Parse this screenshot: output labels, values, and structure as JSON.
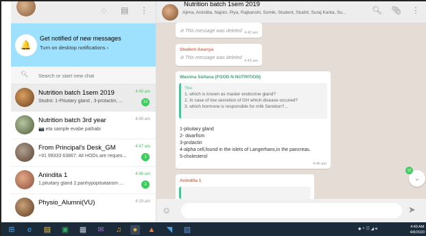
{
  "sidebar": {
    "notify_title": "Get notified of new messages",
    "notify_sub": "Turn on desktop notifications ›",
    "search_placeholder": "Search or start new chat",
    "chats": [
      {
        "name": "Nutrition batch 1sem 2019",
        "snippet": "Studnt: 1-Pituitary gland , 3-prolactin, ...",
        "time": "4:49 am",
        "badge": "12"
      },
      {
        "name": "Nutrition batch 3rd year",
        "snippet": "📷 eta sample evabe pathabi",
        "time": "4:49 am",
        "badge": ""
      },
      {
        "name": "From Principal's Desk_GM",
        "snippet": "+91 99333 63867: All HODs are reques...",
        "time": "4:47 am",
        "badge": "1"
      },
      {
        "name": "Anindita 1",
        "snippet": "1.pituitary gland 2.panhypopituitarism ...",
        "time": "4:46 am",
        "badge": "1"
      },
      {
        "name": "Physio_Alumni(VU)",
        "snippet": "",
        "time": "4:19 am",
        "badge": ""
      }
    ]
  },
  "chat": {
    "title": "Nutrition batch 1sem 2019",
    "members": "Ajima, Anindita, Najnin, Piya, Rajbanshi, Somik, Student, Studnt, Suraj Kanta, Su...",
    "deleted_text": "This message was deleted",
    "msg1_time": "4:42 am",
    "msg2_sender": "Student Ananya",
    "msg2_time": "4:43 am",
    "msg3_sender": "Wasima Sultana (FOOD N NUTRITION)",
    "quote_sender": "You",
    "quote_lines": [
      "1. which is known as master endocrine gland?",
      "2. In case of low secretion of GH which disease occured?",
      "3. which hormone is responsible for milk Seretion?..."
    ],
    "answer_lines": [
      "1-pituitary gland",
      "2- dwarfism",
      "3-prolactin",
      "4-alpha cell,found in the islets of Langerhans,in the pancreas.",
      "5-cholesterol"
    ],
    "msg3_time": "4:46 am",
    "msg4_sender": "Anindita 1",
    "unread_badge": "12"
  },
  "taskbar": {
    "time": "4:49 AM",
    "date": "4/8/2020"
  },
  "colors": {
    "accent": "#3fcc5f",
    "notify_banner": "#9de1fe",
    "chat_bg": "#e5ddd5"
  }
}
